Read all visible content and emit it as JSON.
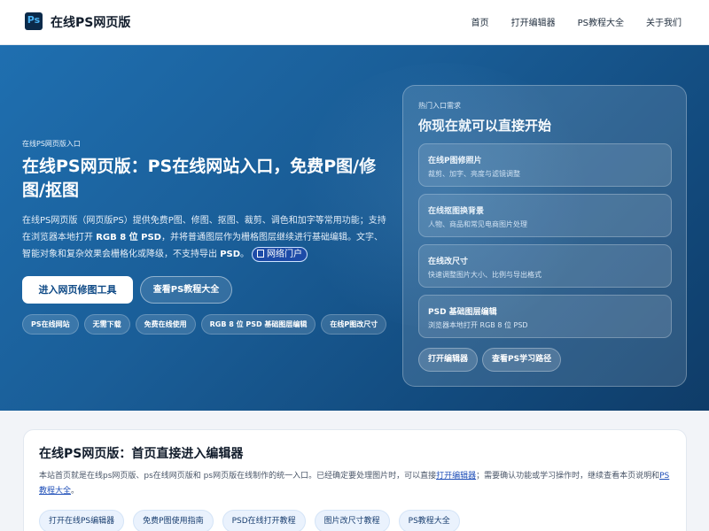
{
  "header": {
    "logo_text": "Ps",
    "brand": "在线PS网页版",
    "nav": [
      "首页",
      "打开编辑器",
      "PS教程大全",
      "关于我们"
    ]
  },
  "hero": {
    "eyebrow": "在线PS网页版入口",
    "title": "在线PS网页版：PS在线网站入口，免费P图/修图/抠图",
    "desc": {
      "part1": "在线PS网页版（网页版PS）提供免费P图、修图、抠图、裁剪、调色和加字等常用功能；支持在浏览器本地打开 ",
      "strong1": "RGB 8 位 PSD",
      "part2": "，并将普通图层作为栅格图层继续进行基础编辑。文字、智能对象和复杂效果会栅格化或降级，不支持导出 ",
      "strong2": "PSD",
      "part3": "。",
      "portal": "网络门户"
    },
    "primary_button": "进入网页修图工具",
    "secondary_button": "查看PS教程大全",
    "tags": [
      "PS在线网站",
      "无需下载",
      "免费在线使用",
      "RGB 8 位 PSD 基础图层编辑",
      "在线P图改尺寸"
    ]
  },
  "panel": {
    "kicker": "热门入口需求",
    "title": "你现在就可以直接开始",
    "cards": [
      {
        "title": "在线P图修照片",
        "subtitle": "裁剪、加字、亮度与滤镜调整"
      },
      {
        "title": "在线抠图换背景",
        "subtitle": "人物、商品和常见电商图片处理"
      },
      {
        "title": "在线改尺寸",
        "subtitle": "快速调整图片大小、比例与导出格式"
      },
      {
        "title": "PSD 基础图层编辑",
        "subtitle": "浏览器本地打开 RGB 8 位 PSD"
      }
    ],
    "buttons": [
      "打开编辑器",
      "查看PS学习路径"
    ]
  },
  "section": {
    "title": "在线PS网页版：首页直接进入编辑器",
    "text1": "本站首页就是在线ps网页版、ps在线网页版和 ps网页版在线制作的统一入口。已经确定要处理图片时，可以直接",
    "link1": "打开编辑器",
    "text2": "；需要确认功能或学习操作时，继续查看本页说明和",
    "link2": "PS教程大全",
    "text3": "。",
    "links": [
      "打开在线PS编辑器",
      "免费P图使用指南",
      "PSD在线打开教程",
      "图片改尺寸教程",
      "PS教程大全"
    ]
  }
}
